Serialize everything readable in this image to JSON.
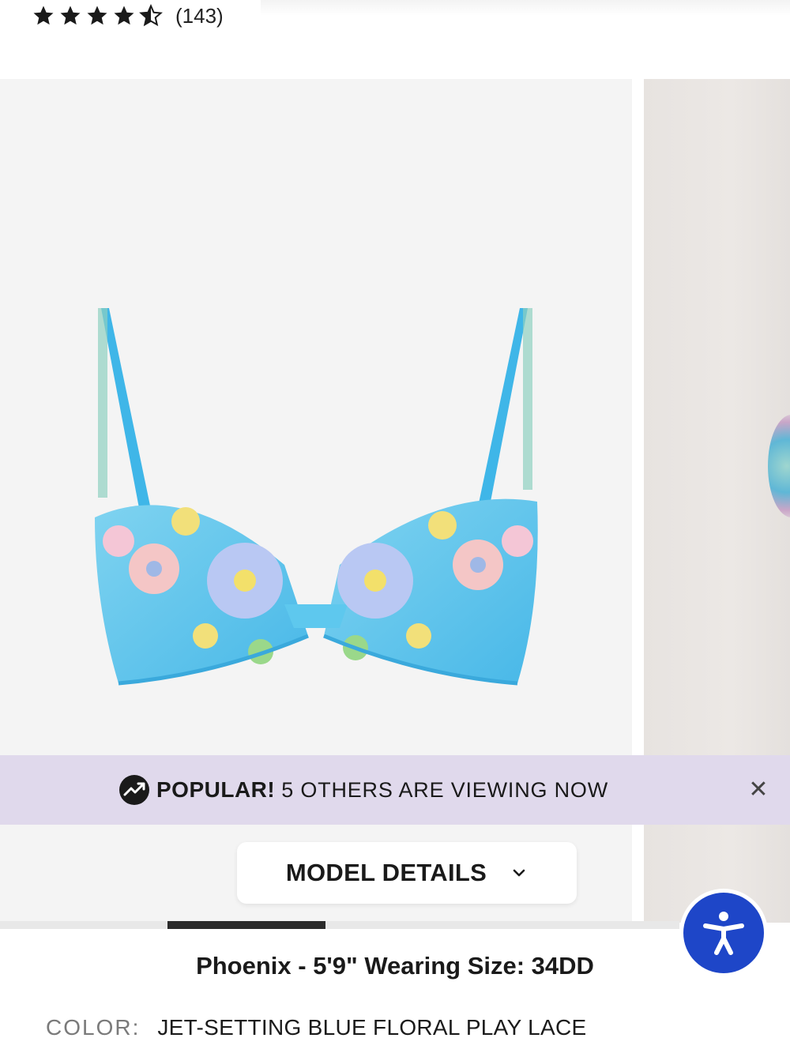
{
  "rating": {
    "value": 4.5,
    "max": 5,
    "review_count": "(143)"
  },
  "popular_banner": {
    "strong": "POPULAR!",
    "text": "5 OTHERS ARE VIEWING NOW",
    "icon": "trending-up-icon",
    "close_icon": "close-icon",
    "background": "#e0d9ec"
  },
  "model_details": {
    "button_label": "MODEL DETAILS",
    "icon": "chevron-down-icon",
    "info": "Phoenix - 5'9\" Wearing Size: 34DD"
  },
  "gallery": {
    "active_slide": 2,
    "image_subject": "product-image"
  },
  "color": {
    "label": "COLOR:",
    "value": "JET-SETTING BLUE FLORAL PLAY LACE"
  },
  "accessibility": {
    "icon": "accessibility-icon",
    "color": "#1e46c8"
  }
}
